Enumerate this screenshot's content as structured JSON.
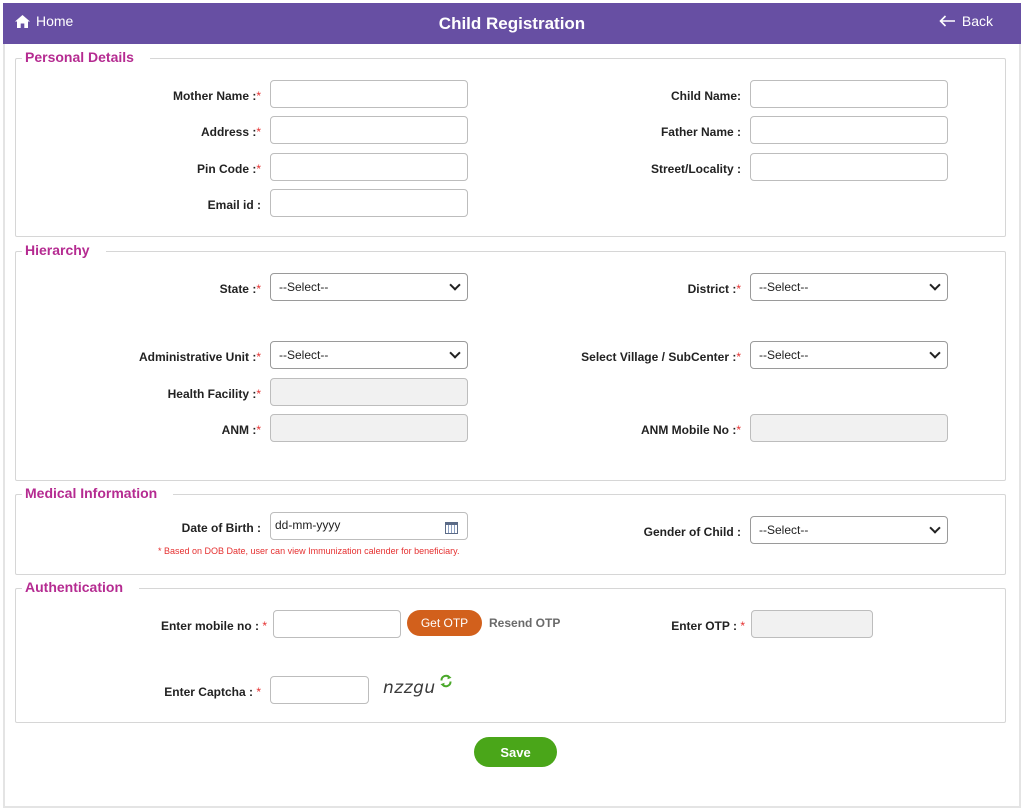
{
  "header": {
    "home_label": "Home",
    "title": "Child Registration",
    "back_label": "Back"
  },
  "personal": {
    "legend": "Personal Details",
    "mother_name_label": "Mother Name :",
    "address_label": "Address :",
    "pin_code_label": "Pin Code :",
    "email_label": "Email id :",
    "child_name_label": "Child Name:",
    "father_name_label": "Father Name :",
    "street_label": "Street/Locality :"
  },
  "hierarchy": {
    "legend": "Hierarchy",
    "state_label": "State :",
    "state_value": "--Select--",
    "district_label": "District :",
    "district_value": "--Select--",
    "admin_unit_label": "Administrative Unit :",
    "admin_unit_value": "--Select--",
    "village_label": "Select Village / SubCenter :",
    "village_value": "--Select--",
    "health_facility_label": "Health Facility :",
    "anm_label": "ANM :",
    "anm_mobile_label": "ANM Mobile No :"
  },
  "medical": {
    "legend": "Medical Information",
    "dob_label": "Date of Birth :",
    "dob_placeholder": "dd-mm-yyyy",
    "dob_note": "* Based on DOB Date, user can view Immunization calender for beneficiary.",
    "gender_label": "Gender of Child :",
    "gender_value": "--Select--"
  },
  "auth": {
    "legend": "Authentication",
    "mobile_label": "Enter mobile no :",
    "get_otp_label": "Get OTP",
    "resend_otp_label": "Resend OTP",
    "otp_label": "Enter OTP :",
    "captcha_label": "Enter Captcha :",
    "captcha_text": "nzzgu"
  },
  "save_label": "Save",
  "colors": {
    "header_bg": "#674fa3",
    "legend": "#b52b91",
    "required": "#e53030",
    "otp_button": "#d2601c",
    "save_button": "#4aa619"
  },
  "icons": {
    "home": "home-icon",
    "back": "arrow-left-icon",
    "calendar": "calendar-icon",
    "refresh": "refresh-icon",
    "dropdown": "chevron-down-icon"
  }
}
